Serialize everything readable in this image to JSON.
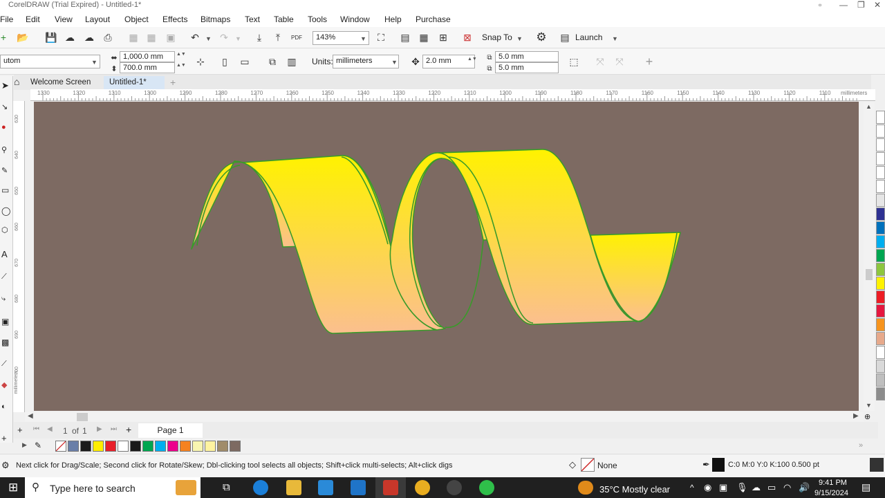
{
  "window": {
    "title": "CorelDRAW (Trial Expired) - Untitled-1*"
  },
  "menu": {
    "items": [
      "File",
      "Edit",
      "View",
      "Layout",
      "Object",
      "Effects",
      "Bitmaps",
      "Text",
      "Table",
      "Tools",
      "Window",
      "Help",
      "Purchase"
    ]
  },
  "standard_toolbar": {
    "zoom_value": "143%",
    "snap_to_label": "Snap To",
    "launch_label": "Launch"
  },
  "property_bar": {
    "page_preset": "utom",
    "page_width": "1,000.0 mm",
    "page_height": "700.0 mm",
    "units_label": "Units:",
    "units_value": "millimeters",
    "nudge_value": "2.0 mm",
    "duplicate_x": "5.0 mm",
    "duplicate_y": "5.0 mm"
  },
  "tabs": [
    {
      "label": "Welcome Screen",
      "active": false
    },
    {
      "label": "Untitled-1*",
      "active": true
    }
  ],
  "rulers": {
    "h_ticks": [
      "1330",
      "1320",
      "1310",
      "1300",
      "1290",
      "1280",
      "1270",
      "1260",
      "1250",
      "1240",
      "1230",
      "1220",
      "1210",
      "1200",
      "1190",
      "1180",
      "1170",
      "1160",
      "1150",
      "1140",
      "1130",
      "1120",
      "1110"
    ],
    "h_unit": "millimeters",
    "v_ticks": [
      "630",
      "640",
      "650",
      "660",
      "670",
      "680",
      "690",
      "700"
    ],
    "v_unit": "millimeters"
  },
  "canvas": {
    "background_color": "#7d6a62",
    "ribbon_fill_top": "#fff200",
    "ribbon_fill_bottom": "#fbbf8e",
    "ribbon_outline": "#3a9a2a"
  },
  "page_navigator": {
    "page_index": "1",
    "of_label": "of",
    "page_total": "1",
    "page_tab_label": "Page 1"
  },
  "document_palette": {
    "swatches": [
      "#6a7fa8",
      "#1a1a1a",
      "#ffee00",
      "#e8202a",
      "#ffffff",
      "#1a1a1a",
      "#00a650",
      "#00aeef",
      "#ec008c",
      "#f58220",
      "#f8f5b0",
      "#fff3a0",
      "#a08c6a",
      "#7d6a62"
    ]
  },
  "color_palette": {
    "swatches": [
      "#ffffff",
      "#ffffff",
      "#ffffff",
      "#ffffff",
      "#ffffff",
      "#ffffff",
      "#e6e6e6",
      "#2e3192",
      "#0071bc",
      "#00aeef",
      "#00a651",
      "#8dc63f",
      "#fff200",
      "#ed1c24",
      "#e5173f",
      "#f7941d",
      "#e7a98b",
      "#ffffff",
      "#d9d9d9",
      "#bfbfbf",
      "#8c8c8c"
    ]
  },
  "status": {
    "hint": "Next click for Drag/Scale; Second click for Rotate/Skew; Dbl-clicking tool selects all objects; Shift+click multi-selects; Alt+click digs",
    "fill_label": "None",
    "outline_label": "C:0 M:0 Y:0 K:100  0.500 pt"
  },
  "taskbar": {
    "search_placeholder": "Type here to search",
    "weather": "35°C  Mostly clear",
    "time": "9:41 PM",
    "date": "9/15/2024"
  }
}
